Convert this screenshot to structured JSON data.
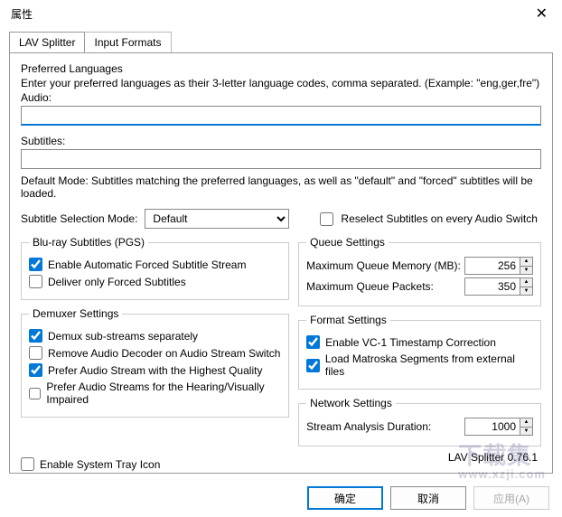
{
  "window": {
    "title": "属性"
  },
  "tabs": {
    "splitter": "LAV Splitter",
    "input_formats": "Input Formats"
  },
  "preferred": {
    "heading": "Preferred Languages",
    "desc": "Enter your preferred languages as their 3-letter language codes, comma separated. (Example: \"eng,ger,fre\")",
    "audio_label": "Audio:",
    "audio_value": "",
    "subtitles_label": "Subtitles:",
    "subtitles_value": "",
    "default_mode_note": "Default Mode: Subtitles matching the preferred languages, as well as \"default\" and \"forced\" subtitles will be loaded."
  },
  "subtitle_mode": {
    "label": "Subtitle Selection Mode:",
    "value": "Default",
    "reselect_label": "Reselect Subtitles on every Audio Switch",
    "reselect_checked": false
  },
  "bluray": {
    "legend": "Blu-ray Subtitles (PGS)",
    "enable_forced_label": "Enable Automatic Forced Subtitle Stream",
    "enable_forced_checked": true,
    "deliver_forced_label": "Deliver only Forced Subtitles",
    "deliver_forced_checked": false
  },
  "demuxer": {
    "legend": "Demuxer Settings",
    "demux_sub_label": "Demux sub-streams separately",
    "demux_sub_checked": true,
    "remove_decoder_label": "Remove Audio Decoder on Audio Stream Switch",
    "remove_decoder_checked": false,
    "prefer_quality_label": "Prefer Audio Stream with the Highest Quality",
    "prefer_quality_checked": true,
    "prefer_impaired_label": "Prefer Audio Streams for the Hearing/Visually Impaired",
    "prefer_impaired_checked": false
  },
  "queue": {
    "legend": "Queue Settings",
    "mem_label": "Maximum Queue Memory (MB):",
    "mem_value": "256",
    "packets_label": "Maximum Queue Packets:",
    "packets_value": "350"
  },
  "format": {
    "legend": "Format Settings",
    "vc1_label": "Enable VC-1 Timestamp Correction",
    "vc1_checked": true,
    "matroska_label": "Load Matroska Segments from external files",
    "matroska_checked": true
  },
  "network": {
    "legend": "Network Settings",
    "duration_label": "Stream Analysis Duration:",
    "duration_value": "1000"
  },
  "tray": {
    "label": "Enable System Tray Icon",
    "checked": false
  },
  "version": "LAV Splitter 0.76.1",
  "watermark": {
    "line1": "下载集",
    "line2": "www.xzji.com"
  },
  "buttons": {
    "ok": "确定",
    "cancel": "取消",
    "apply": "应用(A)"
  }
}
